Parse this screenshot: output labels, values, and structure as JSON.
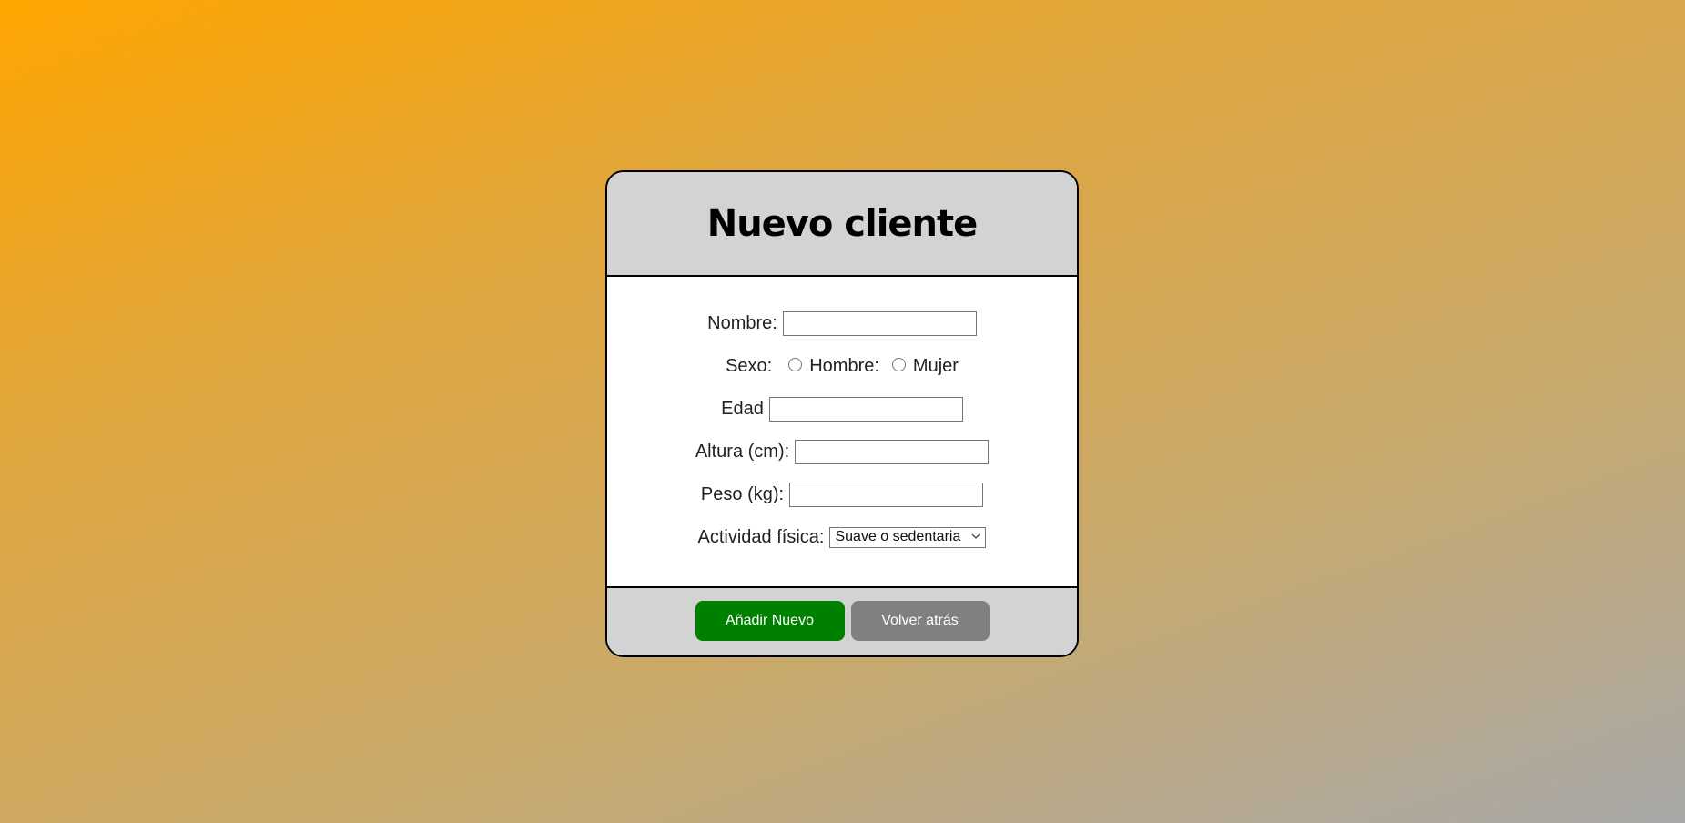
{
  "form": {
    "title": "Nuevo cliente",
    "fields": {
      "nombre": {
        "label": "Nombre:",
        "value": ""
      },
      "sexo": {
        "label": "Sexo:",
        "options": [
          "Hombre:",
          "Mujer"
        ]
      },
      "edad": {
        "label": "Edad",
        "value": ""
      },
      "altura": {
        "label": "Altura (cm):",
        "value": ""
      },
      "peso": {
        "label": "Peso (kg):",
        "value": ""
      },
      "actividad": {
        "label": "Actividad física:",
        "selected": "Suave o sedentaria"
      }
    },
    "buttons": {
      "add": "Añadir Nuevo",
      "back": "Volver atrás"
    }
  },
  "colors": {
    "header_bg": "#d3d3d3",
    "add_button": "#008000",
    "back_button": "#808080",
    "gradient_start": "#ffa500",
    "gradient_end": "#a8a8a8"
  },
  "icons": {
    "select_arrow": "chevron-down-icon"
  }
}
